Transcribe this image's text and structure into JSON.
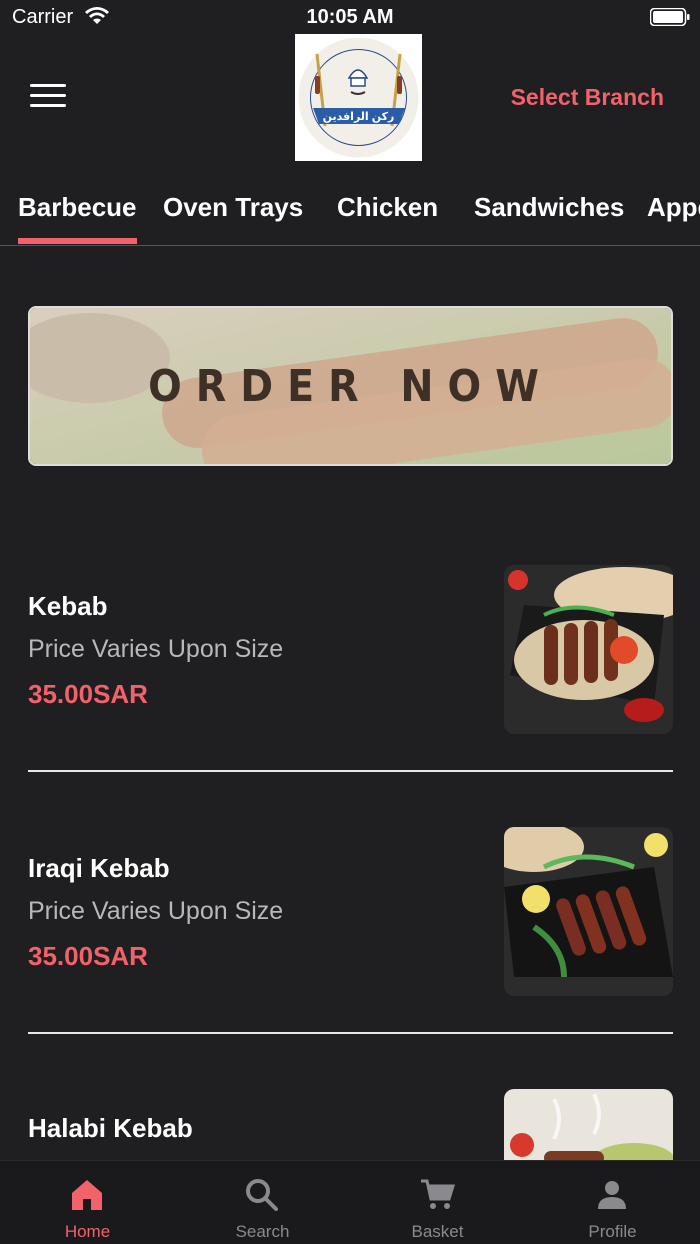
{
  "status_bar": {
    "carrier": "Carrier",
    "time": "10:05 AM"
  },
  "header": {
    "select_branch": "Select Branch",
    "logo_text": "ركن الرافدين"
  },
  "tabs": [
    {
      "label": "Barbecue",
      "active": true
    },
    {
      "label": "Oven Trays"
    },
    {
      "label": "Chicken"
    },
    {
      "label": "Sandwiches"
    },
    {
      "label": "Appetizers"
    }
  ],
  "banner": {
    "text": "ORDER NOW"
  },
  "items": [
    {
      "name": "Kebab",
      "description": "Price Varies Upon Size",
      "price": "35.00SAR"
    },
    {
      "name": "Iraqi Kebab",
      "description": "Price Varies Upon Size",
      "price": "35.00SAR"
    },
    {
      "name": "Halabi Kebab",
      "description": "",
      "price": ""
    }
  ],
  "bottom_nav": [
    {
      "label": "Home",
      "icon": "home-icon",
      "active": true
    },
    {
      "label": "Search",
      "icon": "search-icon"
    },
    {
      "label": "Basket",
      "icon": "cart-icon"
    },
    {
      "label": "Profile",
      "icon": "person-icon"
    }
  ],
  "colors": {
    "accent": "#f2626a",
    "background": "#1f1f22"
  }
}
